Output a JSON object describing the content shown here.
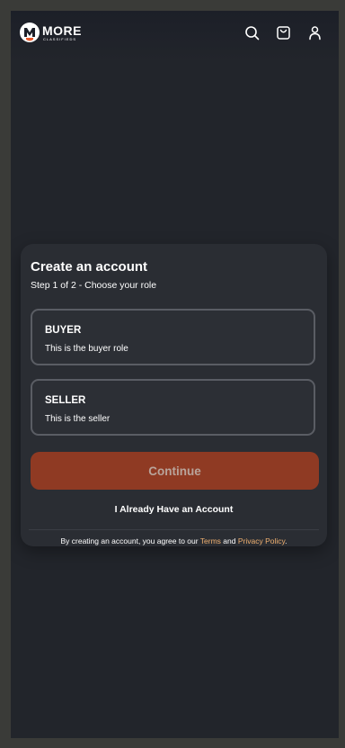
{
  "brand": {
    "name": "MORE",
    "tagline": "CLASSIFIEDS"
  },
  "header": {
    "icons": [
      "search-icon",
      "cart-icon",
      "user-icon"
    ]
  },
  "card": {
    "title": "Create an account",
    "subtitle": "Step 1 of 2 - Choose your role",
    "roles": [
      {
        "title": "BUYER",
        "description": "This is the buyer role"
      },
      {
        "title": "SELLER",
        "description": "This is the seller"
      }
    ],
    "continue_label": "Continue",
    "have_account_label": "I Already Have an Account",
    "legal": {
      "prefix": "By creating an account, you agree to our ",
      "terms": "Terms",
      "and": " and ",
      "privacy": "Privacy Policy",
      "suffix": "."
    }
  },
  "colors": {
    "accent": "#8f3a23",
    "link": "#f0b070",
    "background": "#22252b"
  }
}
